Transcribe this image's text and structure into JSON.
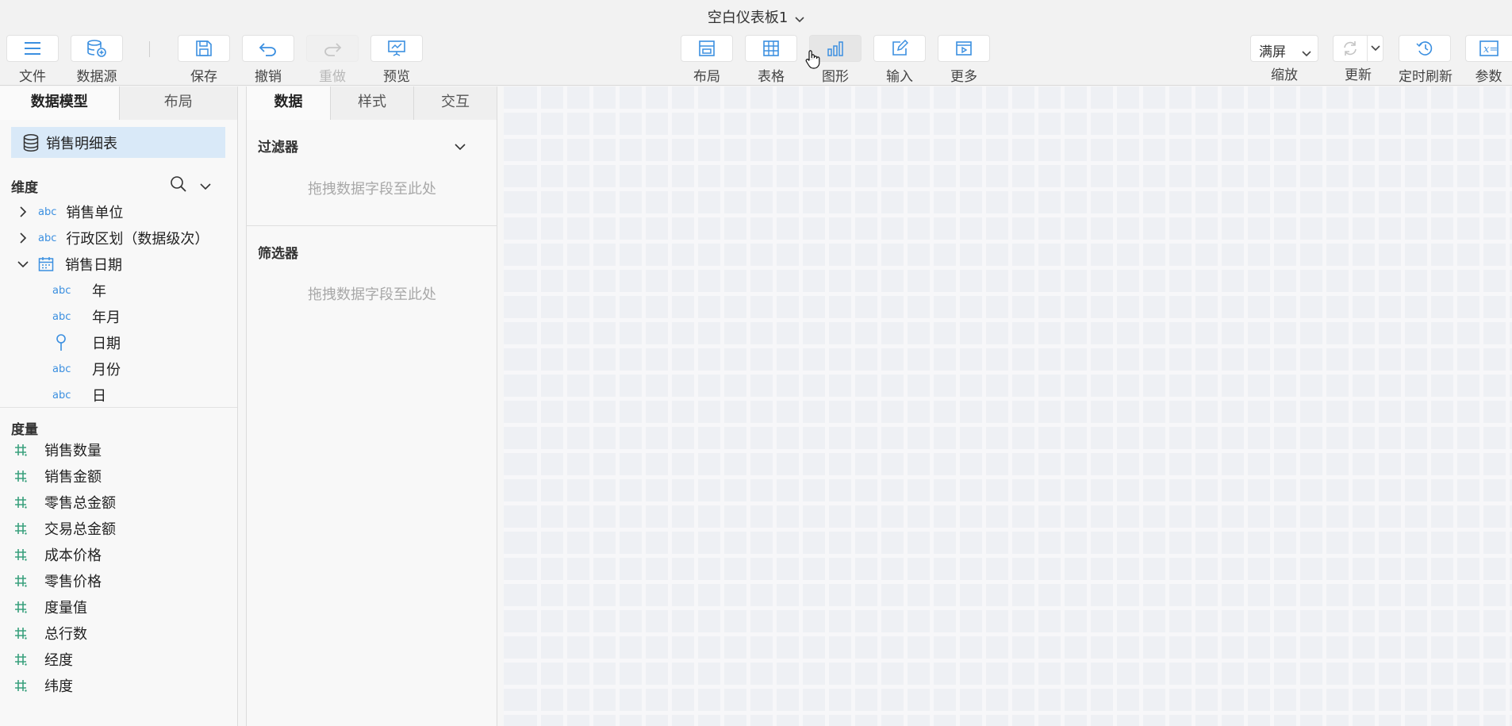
{
  "title": "空白仪表板1",
  "toolbar": {
    "file": "文件",
    "datasource": "数据源",
    "save": "保存",
    "undo": "撤销",
    "redo": "重做",
    "preview": "预览",
    "layout": "布局",
    "table": "表格",
    "chart": "图形",
    "input": "输入",
    "more": "更多",
    "zoom_value": "满屏",
    "zoom_label": "缩放",
    "refresh": "更新",
    "scheduled_refresh": "定时刷新",
    "params": "参数"
  },
  "left": {
    "tabs": [
      "数据模型",
      "布局"
    ],
    "model": "销售明细表",
    "dim_title": "维度",
    "dimensions": [
      {
        "label": "销售单位",
        "type": "abc",
        "expanded": false
      },
      {
        "label": "行政区划（数据级次）",
        "type": "abc",
        "expanded": false
      },
      {
        "label": "销售日期",
        "type": "date",
        "expanded": true
      }
    ],
    "date_children": [
      {
        "label": "年",
        "type": "abc"
      },
      {
        "label": "年月",
        "type": "abc"
      },
      {
        "label": "日期",
        "type": "geo"
      },
      {
        "label": "月份",
        "type": "abc"
      },
      {
        "label": "日",
        "type": "abc"
      }
    ],
    "abc_tag": "abc",
    "measure_title": "度量",
    "measures": [
      "销售数量",
      "销售金额",
      "零售总金额",
      "交易总金额",
      "成本价格",
      "零售价格",
      "度量值",
      "总行数",
      "经度",
      "纬度"
    ]
  },
  "middle": {
    "tabs": [
      "数据",
      "样式",
      "交互"
    ],
    "filter_title": "过滤器",
    "filter_drop": "拖拽数据字段至此处",
    "selector_title": "筛选器",
    "selector_drop": "拖拽数据字段至此处"
  },
  "colors": {
    "accent": "#3b8fe0",
    "measure": "#3aa17e",
    "selected": "#d9e9f8"
  }
}
